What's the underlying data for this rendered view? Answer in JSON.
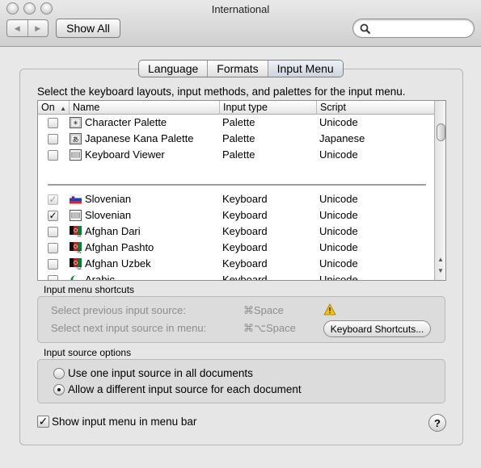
{
  "window": {
    "title": "International"
  },
  "toolbar": {
    "back_label": "◀",
    "forward_label": "▶",
    "show_all_label": "Show All",
    "search_value": ""
  },
  "tabs": [
    {
      "label": "Language",
      "selected": false
    },
    {
      "label": "Formats",
      "selected": false
    },
    {
      "label": "Input Menu",
      "selected": true
    }
  ],
  "instruction": "Select the keyboard layouts, input methods, and palettes for the input menu.",
  "table": {
    "columns": {
      "on": "On",
      "name": "Name",
      "input_type": "Input type",
      "script": "Script"
    },
    "rows": [
      {
        "checked": false,
        "name": "Character Palette",
        "input_type": "Palette",
        "script": "Unicode",
        "icon": "character-palette-icon"
      },
      {
        "checked": false,
        "name": "Japanese Kana Palette",
        "input_type": "Palette",
        "script": "Japanese",
        "icon": "kana-palette-icon"
      },
      {
        "checked": false,
        "name": "Keyboard Viewer",
        "input_type": "Palette",
        "script": "Unicode",
        "icon": "keyboard-viewer-icon"
      },
      {
        "checked": true,
        "dim": true,
        "name": "Slovenian",
        "input_type": "Keyboard",
        "script": "Unicode",
        "icon": "slovenia-flag-icon"
      },
      {
        "checked": true,
        "name": "Slovenian",
        "input_type": "Keyboard",
        "script": "Unicode",
        "icon": "keyboard-icon"
      },
      {
        "checked": false,
        "name": "Afghan Dari",
        "input_type": "Keyboard",
        "script": "Unicode",
        "icon": "afghan-flag-icon"
      },
      {
        "checked": false,
        "name": "Afghan Pashto",
        "input_type": "Keyboard",
        "script": "Unicode",
        "icon": "afghan-flag-icon"
      },
      {
        "checked": false,
        "name": "Afghan Uzbek",
        "input_type": "Keyboard",
        "script": "Unicode",
        "icon": "afghan-flag-icon"
      },
      {
        "checked": false,
        "name": "Arabic",
        "input_type": "Keyboard",
        "script": "Unicode",
        "icon": "crescent-icon"
      }
    ]
  },
  "shortcuts": {
    "group_label": "Input menu shortcuts",
    "previous_label": "Select previous input source:",
    "previous_key": "⌘Space",
    "next_label": "Select next input source in menu:",
    "next_key": "⌘⌥Space",
    "keyboard_shortcuts_button": "Keyboard Shortcuts..."
  },
  "source_options": {
    "group_label": "Input source options",
    "option_all_docs": "Use one input source in all documents",
    "option_each_doc": "Allow a different input source for each document",
    "selected": "each"
  },
  "show_menu": {
    "label": "Show input menu in menu bar",
    "checked": true
  },
  "help_label": "?",
  "colors": {
    "slovenia_blue": "#1d3fb5",
    "slovenia_red": "#d8242a",
    "afghan_green": "#0a7a3a",
    "afghan_red": "#c41d1d",
    "warning_yellow": "#f5c400",
    "crescent_green": "#0a8a32"
  }
}
